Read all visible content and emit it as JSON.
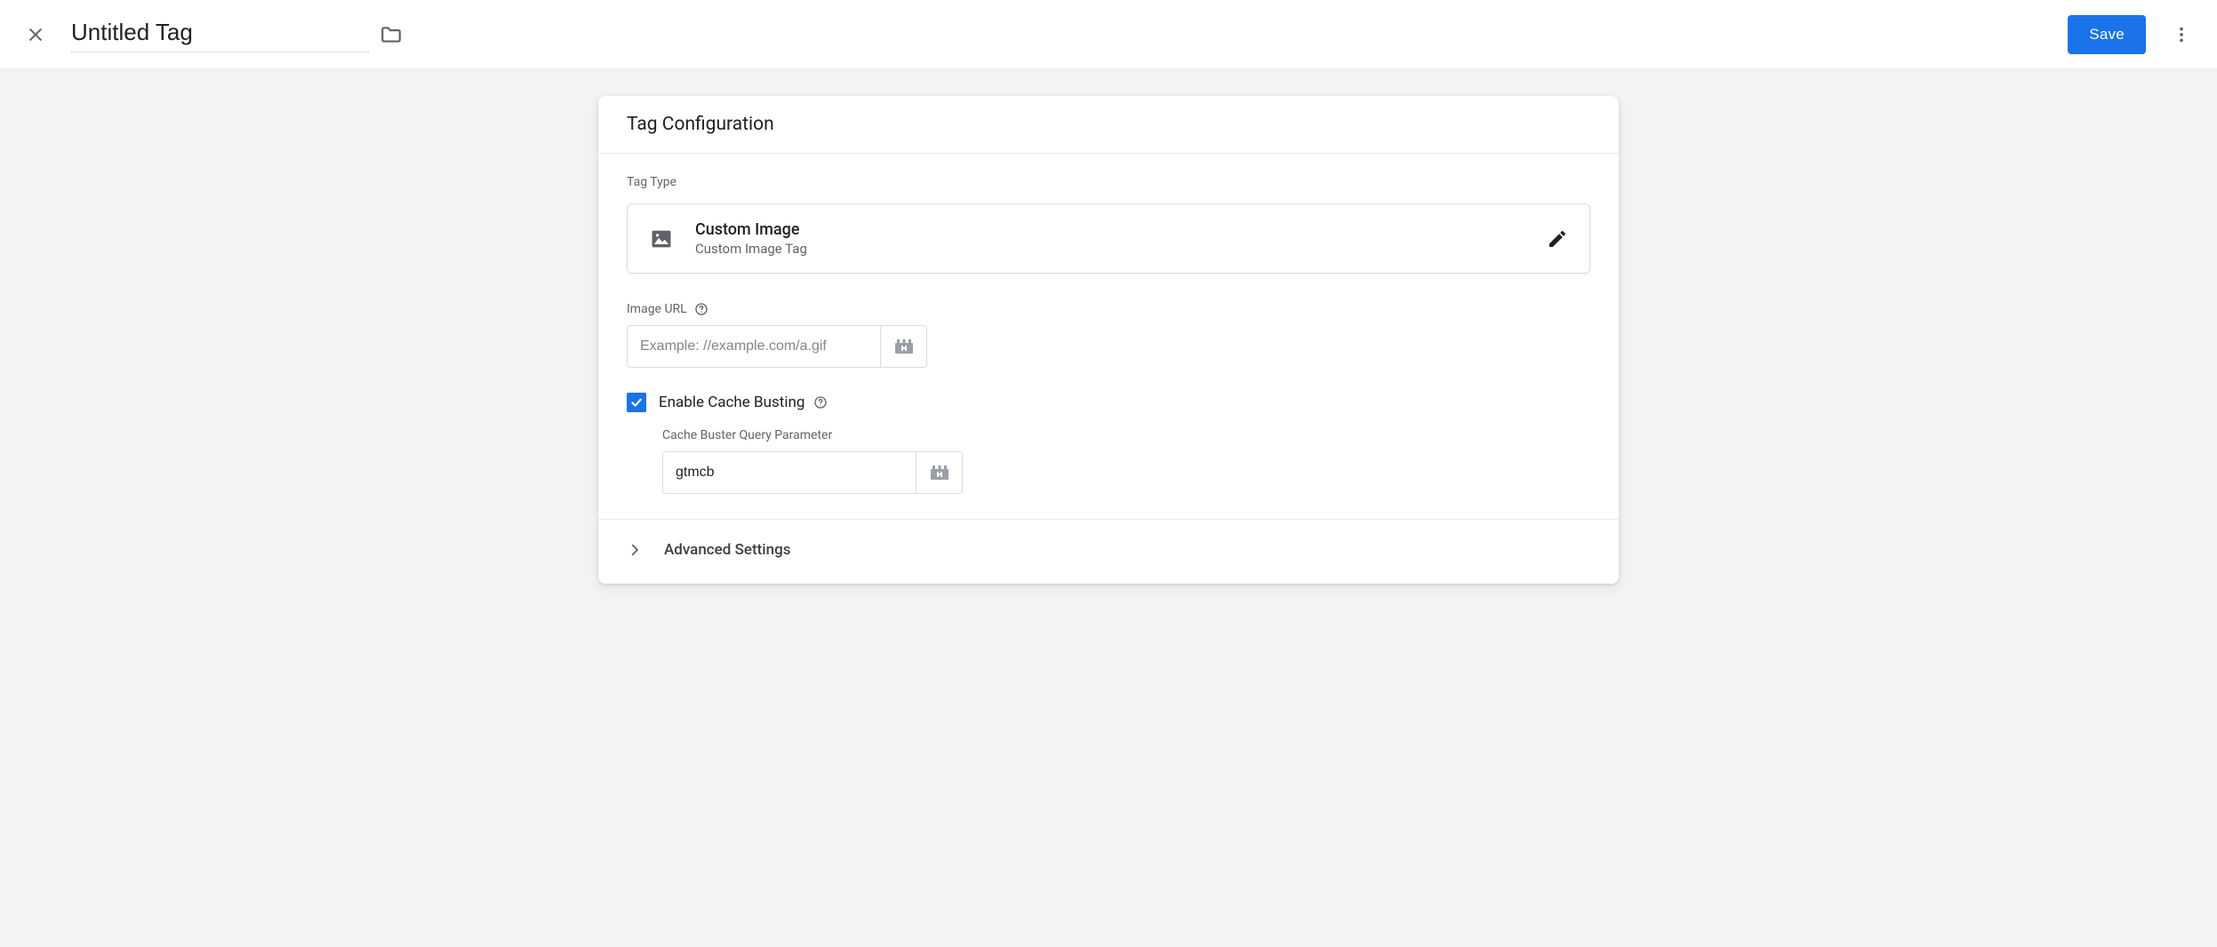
{
  "header": {
    "title": "Untitled Tag",
    "save_label": "Save"
  },
  "card": {
    "title": "Tag Configuration",
    "tag_type_label": "Tag Type",
    "type": {
      "title": "Custom Image",
      "subtitle": "Custom Image Tag"
    },
    "image_url": {
      "label": "Image URL",
      "placeholder": "Example: //example.com/a.gif",
      "value": ""
    },
    "cache_busting": {
      "checked": true,
      "label": "Enable Cache Busting",
      "param_label": "Cache Buster Query Parameter",
      "param_value": "gtmcb"
    },
    "advanced_label": "Advanced Settings"
  }
}
